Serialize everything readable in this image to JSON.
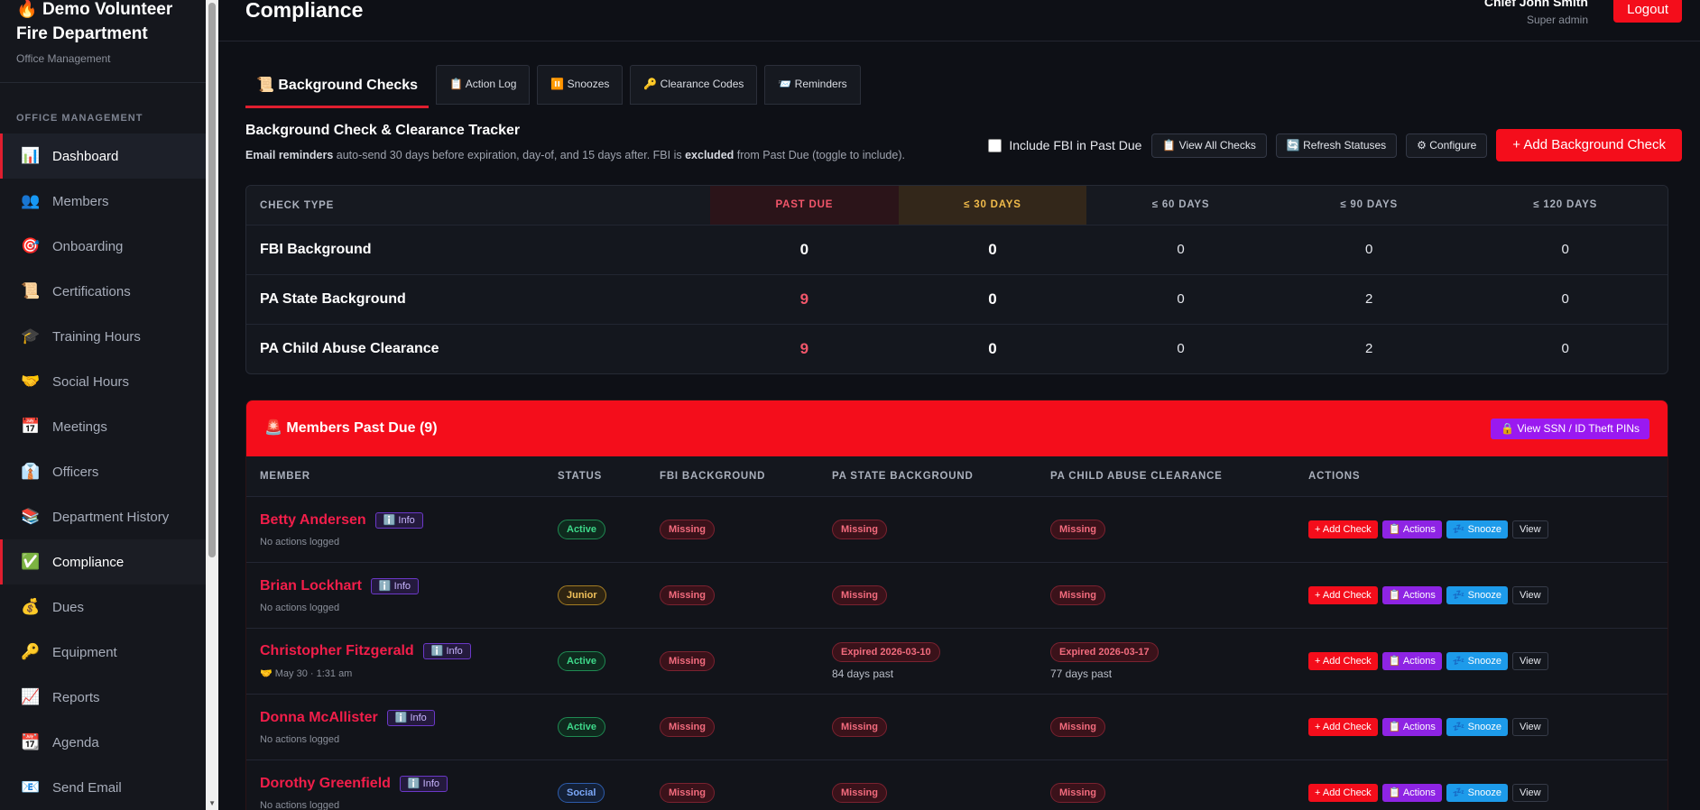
{
  "sidebar": {
    "org_name": "Demo Volunteer Fire Department",
    "org_icon": "🔥",
    "org_sub": "Office Management",
    "section_label": "OFFICE MANAGEMENT",
    "items": [
      {
        "label": "Dashboard",
        "icon": "📊"
      },
      {
        "label": "Members",
        "icon": "👥"
      },
      {
        "label": "Onboarding",
        "icon": "🎯"
      },
      {
        "label": "Certifications",
        "icon": "📜"
      },
      {
        "label": "Training Hours",
        "icon": "🎓"
      },
      {
        "label": "Social Hours",
        "icon": "🤝"
      },
      {
        "label": "Meetings",
        "icon": "📅"
      },
      {
        "label": "Officers",
        "icon": "👔"
      },
      {
        "label": "Department History",
        "icon": "📚"
      },
      {
        "label": "Compliance",
        "icon": "✅"
      },
      {
        "label": "Dues",
        "icon": "💰"
      },
      {
        "label": "Equipment",
        "icon": "🔑"
      },
      {
        "label": "Reports",
        "icon": "📈"
      },
      {
        "label": "Agenda",
        "icon": "📆"
      },
      {
        "label": "Send Email",
        "icon": "📧"
      }
    ]
  },
  "header": {
    "title": "Compliance",
    "user_name": "Chief John Smith",
    "user_role": "Super admin",
    "logout_label": "Logout"
  },
  "tabs": [
    {
      "label": "📜 Background Checks"
    },
    {
      "label": "📋 Action Log"
    },
    {
      "label": "⏸️ Snoozes"
    },
    {
      "label": "🔑 Clearance Codes"
    },
    {
      "label": "📨 Reminders"
    }
  ],
  "tracker": {
    "title": "Background Check & Clearance Tracker",
    "desc_b1": "Email reminders",
    "desc_t1": " auto-send 30 days before expiration, day-of, and 15 days after. FBI is ",
    "desc_b2": "excluded",
    "desc_t2": " from Past Due (toggle to include).",
    "include_fbi_label": "Include FBI in Past Due",
    "view_all_label": "📋 View All Checks",
    "refresh_label": "🔄 Refresh Statuses",
    "configure_label": "⚙ Configure",
    "add_label": "+ Add Background Check"
  },
  "summary": {
    "headers": [
      "CHECK TYPE",
      "PAST DUE",
      "≤ 30 DAYS",
      "≤ 60 DAYS",
      "≤ 90 DAYS",
      "≤ 120 DAYS"
    ],
    "rows": [
      {
        "type": "FBI Background",
        "past_due": "0",
        "d30": "0",
        "d60": "0",
        "d90": "0",
        "d120": "0"
      },
      {
        "type": "PA State Background",
        "past_due": "9",
        "d30": "0",
        "d60": "0",
        "d90": "2",
        "d120": "0"
      },
      {
        "type": "PA Child Abuse Clearance",
        "past_due": "9",
        "d30": "0",
        "d60": "0",
        "d90": "2",
        "d120": "0"
      }
    ]
  },
  "past_due": {
    "title": "🚨 Members Past Due (9)",
    "view_ssn_label": "🔒 View SSN / ID Theft PINs",
    "headers": [
      "MEMBER",
      "STATUS",
      "FBI BACKGROUND",
      "PA STATE BACKGROUND",
      "PA CHILD ABUSE CLEARANCE",
      "ACTIONS"
    ],
    "info_label": "ℹ️ Info",
    "action_labels": {
      "add": "+ Add Check",
      "actions": "📋 Actions",
      "snooze": "💤 Snooze",
      "view": "View"
    },
    "members": [
      {
        "name": "Betty Andersen",
        "note": "No actions logged",
        "status": "Active",
        "fbi": "Missing",
        "state": "Missing",
        "state_sub": "",
        "child": "Missing",
        "child_sub": ""
      },
      {
        "name": "Brian Lockhart",
        "note": "No actions logged",
        "status": "Junior",
        "fbi": "Missing",
        "state": "Missing",
        "state_sub": "",
        "child": "Missing",
        "child_sub": ""
      },
      {
        "name": "Christopher Fitzgerald",
        "note": "🤝 May 30 · 1:31 am",
        "status": "Active",
        "fbi": "Missing",
        "state": "Expired 2026-03-10",
        "state_sub": "84 days past",
        "child": "Expired 2026-03-17",
        "child_sub": "77 days past"
      },
      {
        "name": "Donna McAllister",
        "note": "No actions logged",
        "status": "Active",
        "fbi": "Missing",
        "state": "Missing",
        "state_sub": "",
        "child": "Missing",
        "child_sub": ""
      },
      {
        "name": "Dorothy Greenfield",
        "note": "No actions logged",
        "status": "Social",
        "fbi": "Missing",
        "state": "Missing",
        "state_sub": "",
        "child": "Missing",
        "child_sub": ""
      }
    ]
  }
}
